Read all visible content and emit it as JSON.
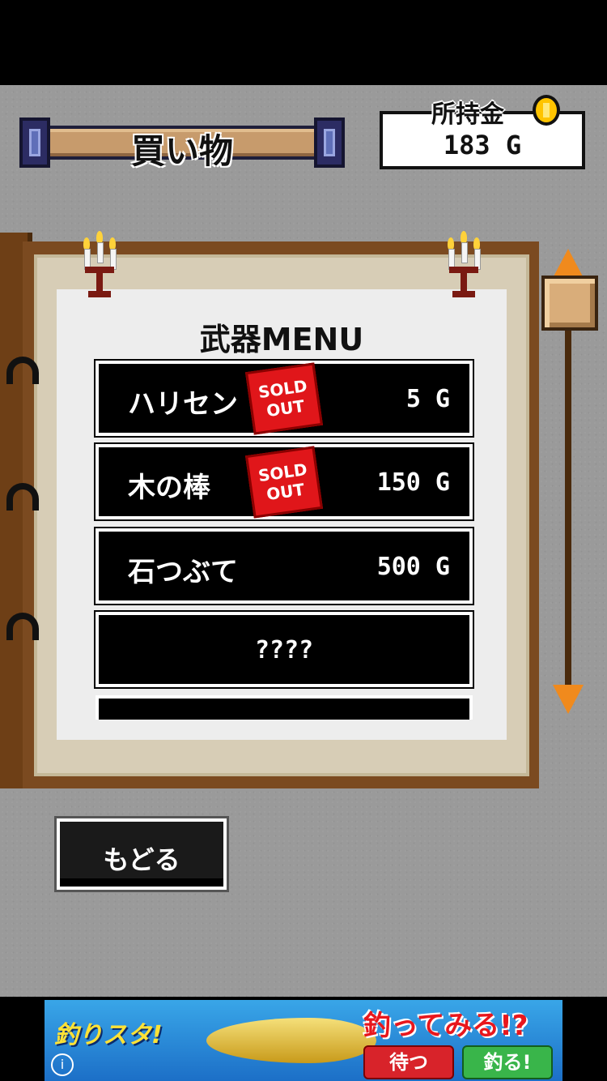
{
  "header": {
    "title": "買い物",
    "money_label": "所持金",
    "money_value": "183 G"
  },
  "menu": {
    "title": "武器MENU",
    "items": [
      {
        "name": "ハリセン",
        "price": "5 G",
        "sold_out": true,
        "badge": "SOLD OUT"
      },
      {
        "name": "木の棒",
        "price": "150 G",
        "sold_out": true,
        "badge": "SOLD OUT"
      },
      {
        "name": "石つぶて",
        "price": "500 G",
        "sold_out": false
      },
      {
        "name": "????",
        "price": "",
        "sold_out": false
      }
    ]
  },
  "back_button": {
    "label": "もどる"
  },
  "ad": {
    "logo": "釣りスタ!",
    "headline": "釣ってみる!?",
    "wait_label": "待つ",
    "fish_label": "釣る!",
    "info": "i"
  },
  "colors": {
    "background": "#9a9a9a",
    "book_brown": "#7b4a20",
    "scroll_arrow": "#f08a1d",
    "sold_out_red": "#e0161a"
  }
}
